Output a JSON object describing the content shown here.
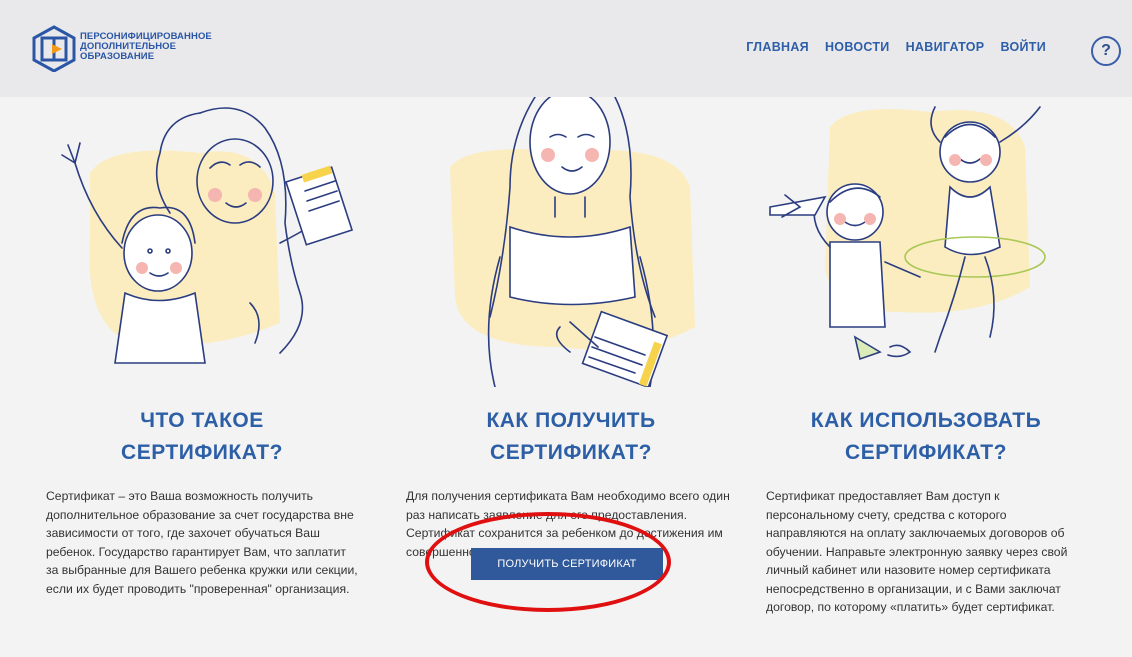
{
  "header": {
    "logo_lines": [
      "ПЕРСОНИФИЦИРОВАННОЕ",
      "ДОПОЛНИТЕЛЬНОЕ",
      "ОБРАЗОВАНИЕ"
    ],
    "nav": [
      "ГЛАВНАЯ",
      "НОВОСТИ",
      "НАВИГАТОР",
      "ВОЙТИ"
    ],
    "help_label": "?"
  },
  "sections": [
    {
      "title_line1": "ЧТО ТАКОЕ",
      "title_line2": "СЕРТИФИКАТ?",
      "text": "Сертификат – это Ваша возможность получить дополнительное образование за счет государства вне зависимости от того, где захочет обучаться Ваш ребенок. Государство гарантирует Вам, что заплатит за выбранные для Вашего ребенка кружки или секции, если их будет проводить \"проверенная\" организация.",
      "illustration_icon": "mother-child-certificate-icon"
    },
    {
      "title_line1": "КАК ПОЛУЧИТЬ",
      "title_line2": "СЕРТИФИКАТ?",
      "text": "Для получения сертификата Вам необходимо всего один раз написать заявление для его предоставления. Сертификат сохранится за ребенком до достижения им совершеннолетия.",
      "illustration_icon": "woman-writing-application-icon"
    },
    {
      "title_line1": "КАК ИСПОЛЬЗОВАТЬ",
      "title_line2": "СЕРТИФИКАТ?",
      "text": "Сертификат предоставляет Вам доступ к персональному счету, средства с которого направляются на оплату заключаемых договоров об обучении. Направьте электронную заявку через свой личный кабинет или назовите номер сертификата непосредственно в организации, и с Вами заключат договор, по которому «платить» будет сертификат.",
      "illustration_icon": "children-activities-icon"
    }
  ],
  "cta": {
    "label": "ПОЛУЧИТЬ СЕРТИФИКАТ"
  },
  "colors": {
    "accent": "#2d5fa7",
    "button": "#30599b",
    "highlight": "#e01010",
    "illustration_bg": "#fbedc0"
  }
}
